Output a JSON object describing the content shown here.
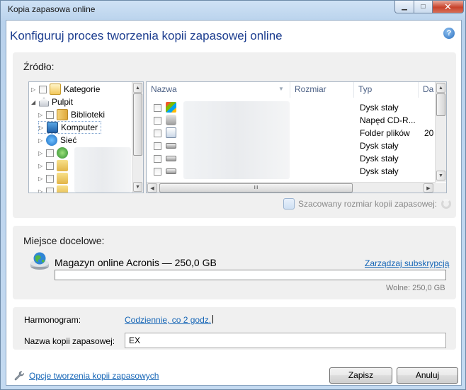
{
  "window": {
    "title": "Kopia zapasowa online",
    "minimize": "▁",
    "maximize": "□",
    "close": "✕"
  },
  "header": {
    "title": "Konfiguruj proces tworzenia kopii zapasowej online",
    "help": "?"
  },
  "source": {
    "label": "Źródło:",
    "tree": [
      {
        "label": "Kategorie",
        "icon": "categories-icon"
      },
      {
        "label": "Pulpit",
        "icon": "home-icon"
      },
      {
        "label": "Biblioteki",
        "icon": "libraries-icon"
      },
      {
        "label": "Komputer",
        "icon": "computer-icon"
      },
      {
        "label": "Sieć",
        "icon": "network-icon"
      }
    ],
    "columns": [
      "Nazwa",
      "Rozmiar",
      "Typ",
      "Da"
    ],
    "rows": [
      {
        "type": "Dysk stały",
        "date": ""
      },
      {
        "type": "Napęd CD-R...",
        "date": ""
      },
      {
        "type": "Folder plików",
        "date": "20"
      },
      {
        "type": "Dysk stały",
        "date": ""
      },
      {
        "type": "Dysk stały",
        "date": ""
      },
      {
        "type": "Dysk stały",
        "date": ""
      }
    ],
    "scroll_grip": "III",
    "estimate_label": "Szacowany rozmiar kopii zapasowej:"
  },
  "destination": {
    "label": "Miejsce docelowe:",
    "storage_name": "Magazyn online Acronis — 250,0 GB",
    "manage_link": "Zarządzaj subskrypcją",
    "usage_fraction": 0,
    "free_label": "Wolne: 250,0 GB"
  },
  "schedule": {
    "label": "Harmonogram:",
    "value": "Codziennie, co 2 godz.",
    "name_label": "Nazwa kopii zapasowej:",
    "name_value": "EX"
  },
  "footer": {
    "options_link": "Opcje tworzenia kopii zapasowych",
    "save": "Zapisz",
    "cancel": "Anuluj"
  }
}
